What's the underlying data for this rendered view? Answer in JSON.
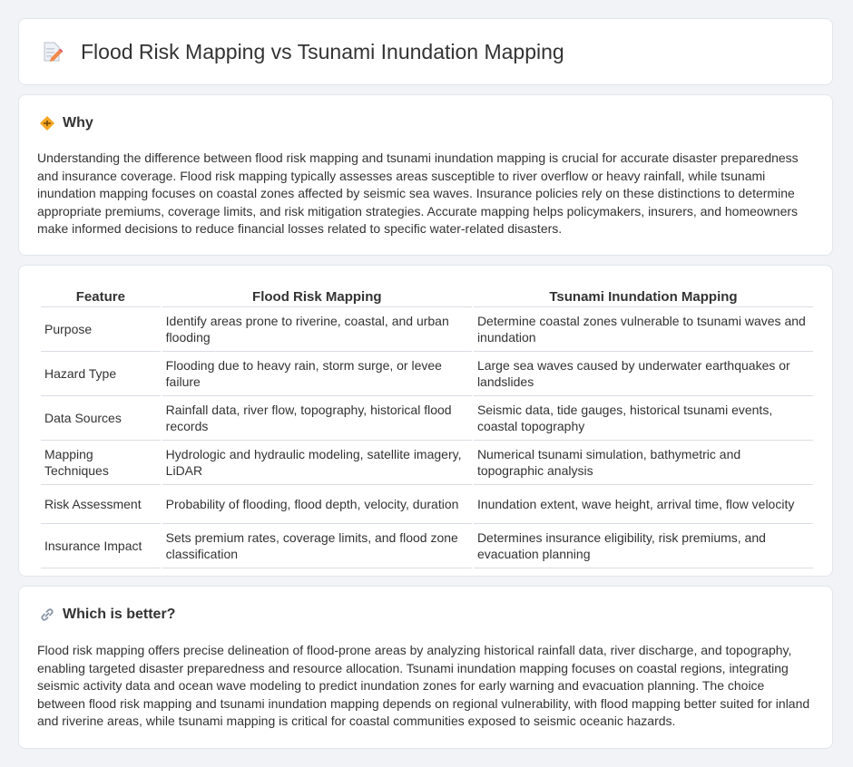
{
  "page": {
    "title": "Flood Risk Mapping vs Tsunami Inundation Mapping",
    "title_icon": "document-pencil-icon"
  },
  "why": {
    "heading": "Why",
    "icon": "diamond-warning-icon",
    "text": "Understanding the difference between flood risk mapping and tsunami inundation mapping is crucial for accurate disaster preparedness and insurance coverage. Flood risk mapping typically assesses areas susceptible to river overflow or heavy rainfall, while tsunami inundation mapping focuses on coastal zones affected by seismic sea waves. Insurance policies rely on these distinctions to determine appropriate premiums, coverage limits, and risk mitigation strategies. Accurate mapping helps policymakers, insurers, and homeowners make informed decisions to reduce financial losses related to specific water-related disasters."
  },
  "table": {
    "headers": [
      "Feature",
      "Flood Risk Mapping",
      "Tsunami Inundation Mapping"
    ],
    "rows": [
      [
        "Purpose",
        "Identify areas prone to riverine, coastal, and urban flooding",
        "Determine coastal zones vulnerable to tsunami waves and inundation"
      ],
      [
        "Hazard Type",
        "Flooding due to heavy rain, storm surge, or levee failure",
        "Large sea waves caused by underwater earthquakes or landslides"
      ],
      [
        "Data Sources",
        "Rainfall data, river flow, topography, historical flood records",
        "Seismic data, tide gauges, historical tsunami events, coastal topography"
      ],
      [
        "Mapping Techniques",
        "Hydrologic and hydraulic modeling, satellite imagery, LiDAR",
        "Numerical tsunami simulation, bathymetric and topographic analysis"
      ],
      [
        "Risk Assessment",
        "Probability of flooding, flood depth, velocity, duration",
        "Inundation extent, wave height, arrival time, flow velocity"
      ],
      [
        "Insurance Impact",
        "Sets premium rates, coverage limits, and flood zone classification",
        "Determines insurance eligibility, risk premiums, and evacuation planning"
      ]
    ]
  },
  "better": {
    "heading": "Which is better?",
    "icon": "link-icon",
    "text": "Flood risk mapping offers precise delineation of flood-prone areas by analyzing historical rainfall data, river discharge, and topography, enabling targeted disaster preparedness and resource allocation. Tsunami inundation mapping focuses on coastal regions, integrating seismic activity data and ocean wave modeling to predict inundation zones for early warning and evacuation planning. The choice between flood risk mapping and tsunami inundation mapping depends on regional vulnerability, with flood mapping better suited for inland and riverine areas, while tsunami mapping is critical for coastal communities exposed to seismic oceanic hazards."
  }
}
